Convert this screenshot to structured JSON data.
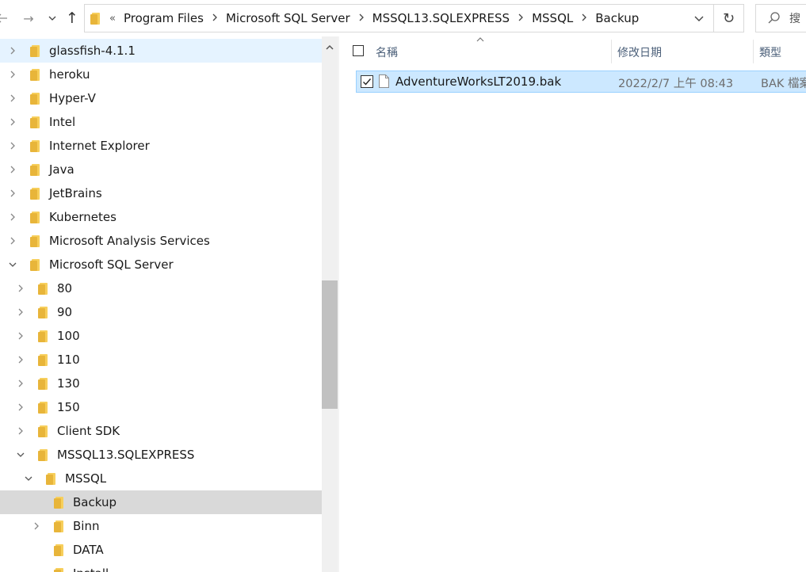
{
  "nav": {
    "back_icon": "back-arrow-icon",
    "forward_glyph": "→",
    "recent_glyph": "⌄",
    "up_glyph": "↑"
  },
  "address": {
    "overflow": "«",
    "crumbs": [
      "Program Files",
      "Microsoft SQL Server",
      "MSSQL13.SQLEXPRESS",
      "MSSQL",
      "Backup"
    ]
  },
  "refresh_glyph": "↻",
  "search": {
    "placeholder": "搜"
  },
  "tree": [
    {
      "label": "glassfish-4.1.1",
      "expanded": false
    },
    {
      "label": "heroku",
      "expanded": false
    },
    {
      "label": "Hyper-V",
      "expanded": false
    },
    {
      "label": "Intel",
      "expanded": false
    },
    {
      "label": "Internet Explorer",
      "expanded": false
    },
    {
      "label": "Java",
      "expanded": false
    },
    {
      "label": "JetBrains",
      "expanded": false
    },
    {
      "label": "Kubernetes",
      "expanded": false
    },
    {
      "label": "Microsoft Analysis Services",
      "expanded": false
    },
    {
      "label": "Microsoft SQL Server",
      "expanded": true
    },
    {
      "label": "80",
      "expanded": false
    },
    {
      "label": "90",
      "expanded": false
    },
    {
      "label": "100",
      "expanded": false
    },
    {
      "label": "110",
      "expanded": false
    },
    {
      "label": "130",
      "expanded": false
    },
    {
      "label": "150",
      "expanded": false
    },
    {
      "label": "Client SDK",
      "expanded": false
    },
    {
      "label": "MSSQL13.SQLEXPRESS",
      "expanded": true
    },
    {
      "label": "MSSQL",
      "expanded": true
    },
    {
      "label": "Backup",
      "expanded": false,
      "selected": true
    },
    {
      "label": "Binn",
      "expanded": false
    },
    {
      "label": "DATA",
      "expanded": false
    },
    {
      "label": "Install",
      "expanded": false
    }
  ],
  "columns": {
    "name": "名稱",
    "date": "修改日期",
    "type": "類型"
  },
  "files": [
    {
      "name": "AdventureWorksLT2019.bak",
      "date": "2022/2/7 上午 08:43",
      "type": "BAK 檔案",
      "checked": true
    }
  ],
  "colors": {
    "hover": "#e5f3ff",
    "selected_tree": "#d9d9d9",
    "selected_file": "#cce8ff",
    "folder": "#f7cf5c"
  }
}
